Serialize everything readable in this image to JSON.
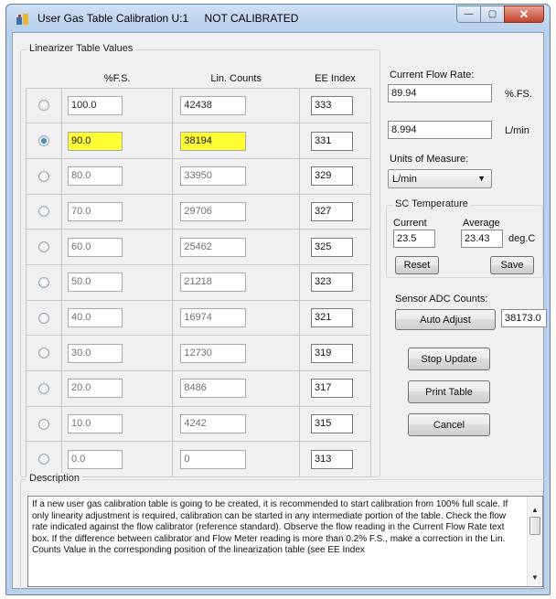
{
  "window": {
    "title": "User Gas Table Calibration U:1",
    "status": "NOT CALIBRATED",
    "minimize_glyph": "—",
    "maximize_glyph": "▢",
    "close_glyph": "✕"
  },
  "table": {
    "group_label": "Linearizer Table Values",
    "headers": {
      "fs": "%F.S.",
      "lin": "Lin. Counts",
      "ee": "EE Index"
    },
    "rows": [
      {
        "fs": "100.0",
        "lin": "42438",
        "ee": "333",
        "selected": false
      },
      {
        "fs": "90.0",
        "lin": "38194",
        "ee": "331",
        "selected": true
      },
      {
        "fs": "80.0",
        "lin": "33950",
        "ee": "329",
        "selected": false
      },
      {
        "fs": "70.0",
        "lin": "29706",
        "ee": "327",
        "selected": false
      },
      {
        "fs": "60.0",
        "lin": "25462",
        "ee": "325",
        "selected": false
      },
      {
        "fs": "50.0",
        "lin": "21218",
        "ee": "323",
        "selected": false
      },
      {
        "fs": "40.0",
        "lin": "16974",
        "ee": "321",
        "selected": false
      },
      {
        "fs": "30.0",
        "lin": "12730",
        "ee": "319",
        "selected": false
      },
      {
        "fs": "20.0",
        "lin": "8486",
        "ee": "317",
        "selected": false
      },
      {
        "fs": "10.0",
        "lin": "4242",
        "ee": "315",
        "selected": false
      },
      {
        "fs": "0.0",
        "lin": "0",
        "ee": "313",
        "selected": false
      }
    ],
    "highlight_color": "#ffff33"
  },
  "flow": {
    "label": "Current Flow Rate:",
    "fs_value": "89.94",
    "fs_unit": "%.FS.",
    "lmin_value": "8.994",
    "lmin_unit": "L/min"
  },
  "units": {
    "label": "Units of Measure:",
    "selected": "L/min"
  },
  "sc_temp": {
    "label": "SC Temperature",
    "current_label": "Current",
    "average_label": "Average",
    "current_value": "23.5",
    "average_value": "23.43",
    "unit": "deg.C",
    "reset_label": "Reset",
    "save_label": "Save"
  },
  "adc": {
    "label": "Sensor ADC Counts:",
    "auto_adjust_label": "Auto Adjust",
    "value": "38173.0"
  },
  "buttons": {
    "stop_update": "Stop Update",
    "print_table": "Print Table",
    "cancel": "Cancel"
  },
  "description": {
    "label": "Description",
    "text": "If a new user gas calibration table is going to be created, it is recommended to start calibration from 100% full scale. If only linearity adjustment is required, calibration can be started in any intermediate portion of the table. Check the flow rate indicated against the flow calibrator (reference standard). Observe the flow reading in the Current Flow Rate text box. If the difference between calibrator and Flow Meter reading is more than 0.2% F.S., make a correction in the Lin. Counts Value in the corresponding position of the linearization table (see EE Index"
  }
}
